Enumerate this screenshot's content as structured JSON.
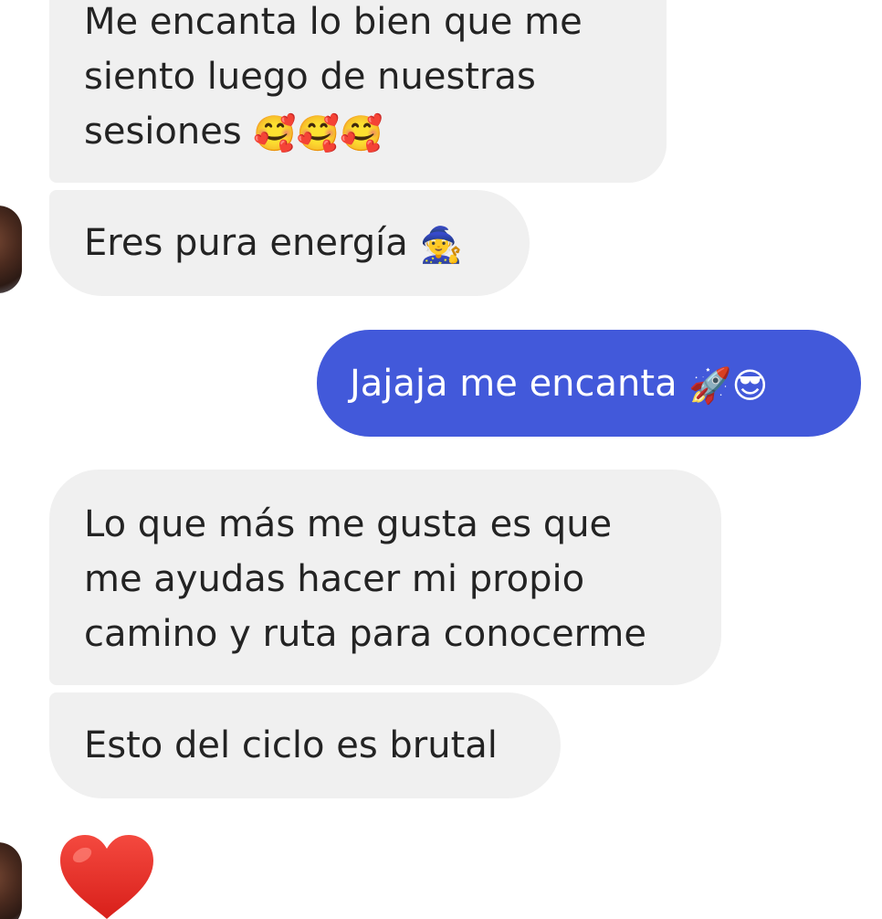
{
  "conversation": {
    "messages": [
      {
        "direction": "incoming",
        "lines": [
          "Me encanta lo bien que me",
          "siento luego de nuestras",
          "sesiones"
        ],
        "emoji": "🥰🥰🥰"
      },
      {
        "direction": "incoming",
        "text": "Eres pura energía",
        "emoji": "🧙"
      },
      {
        "direction": "outgoing",
        "text": "Jajaja me encanta",
        "emoji": "🚀😎"
      },
      {
        "direction": "incoming",
        "lines": [
          "Lo que más me gusta es que",
          "me ayudas hacer mi propio",
          "camino y ruta para conocerme"
        ]
      },
      {
        "direction": "incoming",
        "text": "Esto del ciclo es brutal"
      },
      {
        "direction": "incoming",
        "type": "reaction",
        "emoji": "❤️"
      }
    ]
  },
  "colors": {
    "incoming_bubble": "#f0f0f0",
    "outgoing_bubble": "#4259da",
    "incoming_text": "#232323",
    "outgoing_text": "#ffffff",
    "heart": "#e8312b"
  },
  "icons": {
    "avatar": "contact-avatar",
    "heart": "heart-icon"
  }
}
